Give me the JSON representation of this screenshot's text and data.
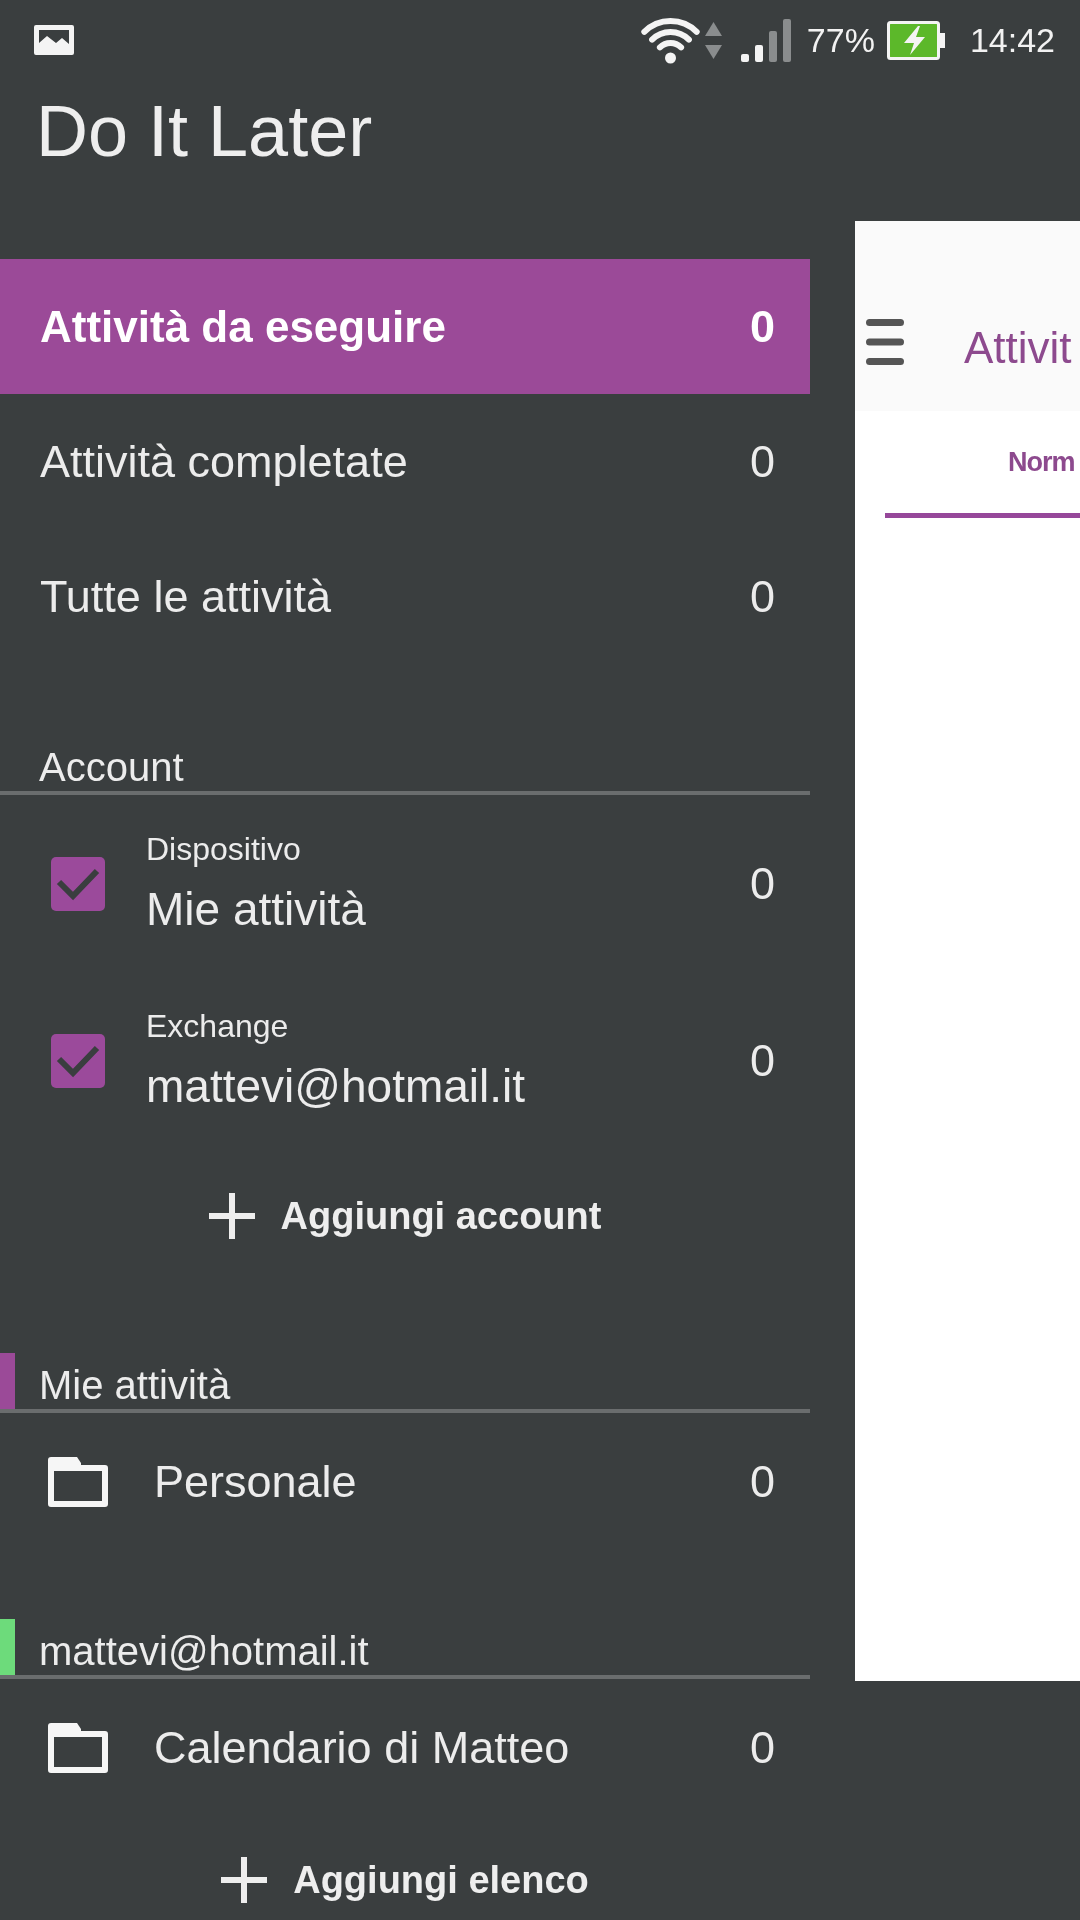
{
  "status_bar": {
    "battery": "77%",
    "time": "14:42"
  },
  "app_title": "Do It Later",
  "drawer": {
    "views": [
      {
        "label": "Attività da eseguire",
        "count": "0",
        "selected": true
      },
      {
        "label": "Attività completate",
        "count": "0",
        "selected": false
      },
      {
        "label": "Tutte le attività",
        "count": "0",
        "selected": false
      }
    ],
    "accounts_header": "Account",
    "accounts": [
      {
        "account_type": "Dispositivo",
        "name": "Mie attività",
        "count": "0",
        "checked": true
      },
      {
        "account_type": "Exchange",
        "name": "mattevi@hotmail.it",
        "count": "0",
        "checked": true
      }
    ],
    "add_account_button": "Aggiungi account",
    "list_groups": [
      {
        "title": "Mie attività",
        "color": "#9b4a98",
        "lists": [
          {
            "name": "Personale",
            "count": "0"
          }
        ]
      },
      {
        "title": "mattevi@hotmail.it",
        "color": "#6ddb7b",
        "lists": [
          {
            "name": "Calendario di Matteo",
            "count": "0"
          }
        ]
      }
    ],
    "add_list_button": "Aggiungi elenco"
  },
  "main_panel": {
    "title": "Attivit",
    "tabs": [
      {
        "label": "Norm",
        "selected": true
      }
    ]
  }
}
